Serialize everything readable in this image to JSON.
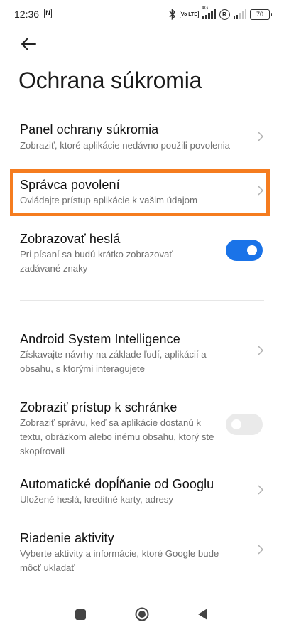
{
  "status_bar": {
    "time": "12:36",
    "nfc_label": "N",
    "volte_label": "Vo LTE",
    "network_label": "4G",
    "roaming_label": "R",
    "battery": "70"
  },
  "header": {
    "back_icon": "arrow-left-icon",
    "title": "Ochrana súkromia"
  },
  "items": [
    {
      "title": "Panel ochrany súkromia",
      "subtitle": "Zobraziť, ktoré aplikácie nedávno použili povolenia",
      "control": "chevron"
    },
    {
      "title": "Správca povolení",
      "subtitle": "Ovládajte prístup aplikácie k vašim údajom",
      "control": "chevron",
      "highlighted": true
    },
    {
      "title": "Zobrazovať heslá",
      "subtitle": "Pri písaní sa budú krátko zobrazovať zadávané znaky",
      "control": "toggle",
      "enabled": true
    },
    {
      "title": "Android System Intelligence",
      "subtitle": "Získavajte návrhy na základe ľudí, aplikácií a obsahu, s ktorými interagujete",
      "control": "chevron"
    },
    {
      "title": "Zobraziť prístup k schránke",
      "subtitle": "Zobraziť správu, keď sa aplikácie dostanú k textu, obrázkom alebo inému obsahu, ktorý ste skopírovali",
      "control": "toggle",
      "enabled": false
    },
    {
      "title": "Automatické dopĺňanie od Googlu",
      "subtitle": "Uložené heslá, kreditné karty, adresy",
      "control": "chevron"
    },
    {
      "title": "Riadenie aktivity",
      "subtitle": "Vyberte aktivity a informácie, ktoré Google bude môcť ukladať",
      "control": "chevron"
    }
  ],
  "colors": {
    "accent": "#1a73e8",
    "highlight": "#f57c1f",
    "toggle_off": "#eaeaea"
  },
  "nav_bar": {
    "icons": [
      "recents-square-icon",
      "home-circle-icon",
      "back-triangle-icon"
    ]
  }
}
